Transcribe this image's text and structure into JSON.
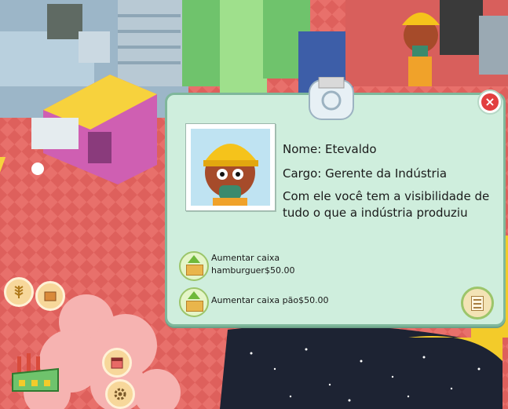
{
  "dialog": {
    "name_line": "Nome: Etevaldo",
    "role_line": "Cargo: Gerente da Indústria",
    "desc_line1": "Com ele você tem a visibilidade de",
    "desc_line2": "tudo o que a indústria produziu"
  },
  "upgrades": [
    {
      "line1": "Aumentar caixa",
      "line2": "hamburguer$50.00"
    },
    {
      "line1": "Aumentar caixa pão$50.00"
    }
  ],
  "icons": {
    "close": "close-icon",
    "list": "list-icon",
    "grain": "grain-icon",
    "crate": "crate-icon",
    "factory": "factory-icon",
    "calendar": "calendar-icon",
    "settings": "gear-icon"
  },
  "colors": {
    "floor": "#e86a66",
    "panel": "#cfeedd",
    "panel_border": "#7fb79b",
    "close": "#e23f3f",
    "upgrade": "#6fb83a"
  }
}
